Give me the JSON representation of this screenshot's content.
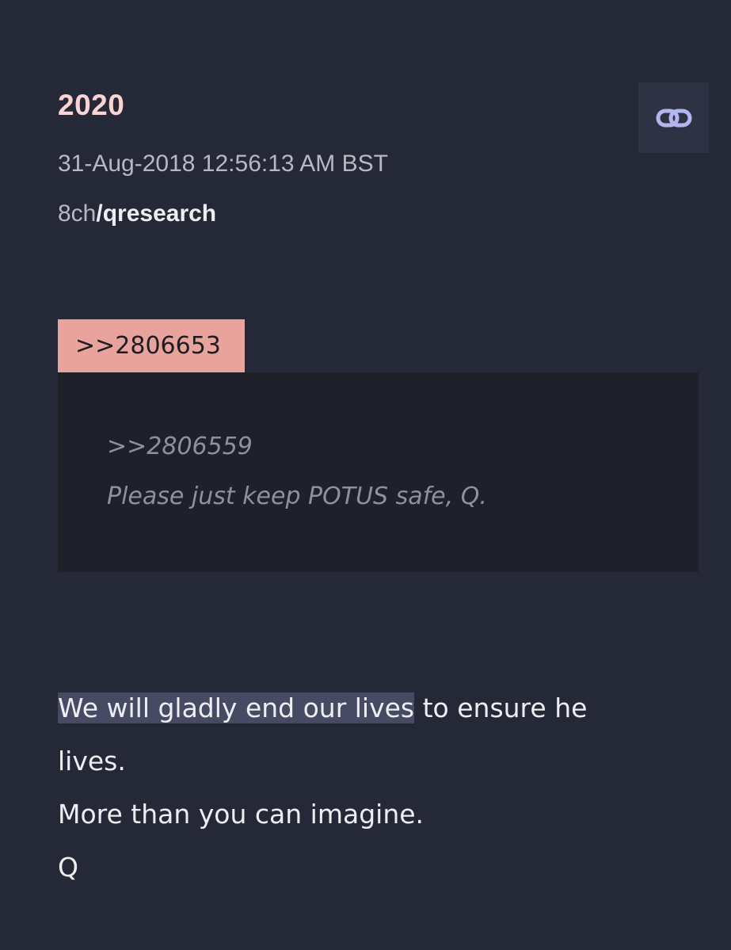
{
  "post": {
    "number": "2020",
    "timestamp": "31-Aug-2018 12:56:13 AM BST",
    "board_prefix": "8ch",
    "board_name": "/qresearch",
    "link_icon": "link-icon"
  },
  "reply": {
    "reference": ">>2806653",
    "quoted_reference": ">>2806559",
    "quoted_text": "Please just keep POTUS safe, Q."
  },
  "message": {
    "highlighted": "We will gladly end our lives",
    "line1_rest": " to ensure he",
    "line2": "lives.",
    "line3": "More than you can imagine.",
    "signature": "Q"
  },
  "colors": {
    "background": "#252836",
    "post_number": "#f8d4d4",
    "reply_tag": "#e9a39d",
    "quote_block": "#1f2029",
    "highlight": "#474a63"
  }
}
